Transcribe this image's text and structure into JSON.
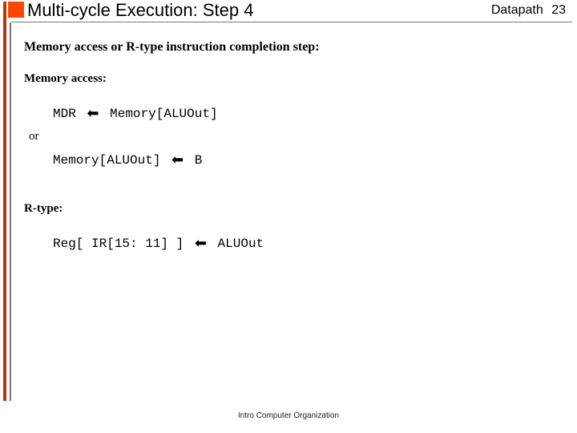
{
  "header": {
    "title": "Multi-cycle Execution: Step 4",
    "section_label": "Datapath",
    "page_number": "23"
  },
  "content": {
    "main_heading": "Memory access or R-type instruction completion step:",
    "mem_heading": "Memory access:",
    "line1_left": "MDR",
    "line1_right": "Memory[ALUOut]",
    "or_label": "or",
    "line2_left": "Memory[ALUOut]",
    "line2_right": "B",
    "rtype_heading": "R-type:",
    "line3_left": "Reg[ IR[15: 11] ]",
    "line3_right": "ALUOut",
    "arrow": "⬅"
  },
  "footer": {
    "text": "Intro Computer Organization"
  }
}
